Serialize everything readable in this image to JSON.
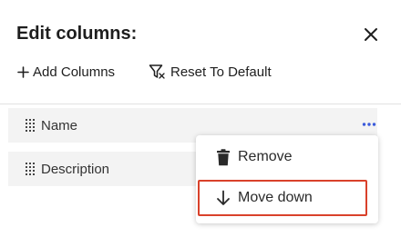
{
  "dialog": {
    "title": "Edit columns:",
    "close_icon": "close-icon"
  },
  "toolbar": {
    "add_label": "Add Columns",
    "add_icon": "plus-icon",
    "reset_label": "Reset To Default",
    "reset_icon": "filter-reset-icon"
  },
  "columns": [
    {
      "label": "Name",
      "icon": "drag-handle-icon"
    },
    {
      "label": "Description",
      "icon": "drag-handle-icon"
    }
  ],
  "context_menu": {
    "trigger_icon": "more-horizontal-icon",
    "items": [
      {
        "label": "Remove",
        "icon": "trash-icon"
      },
      {
        "label": "Move down",
        "icon": "arrow-down-icon"
      }
    ]
  },
  "colors": {
    "accent": "#3b5bdb",
    "highlight_border": "#d9412a",
    "row_background": "#f3f3f3"
  }
}
